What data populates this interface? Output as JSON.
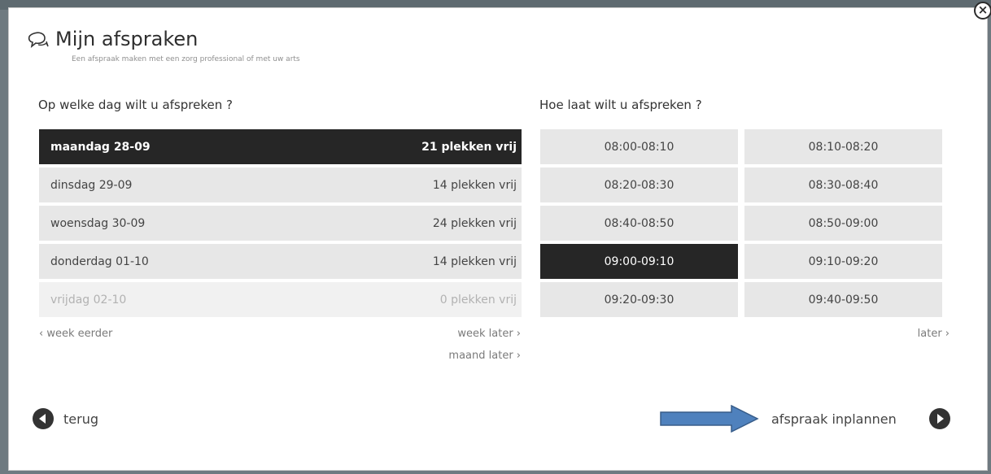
{
  "dialog": {
    "title": "Mijn afspraken",
    "subtitle": "Een afspraak maken met een zorg professional of met uw arts",
    "close_label": "×"
  },
  "days": {
    "heading": "Op welke dag wilt u afspreken ?",
    "items": [
      {
        "day": "maandag 28-09",
        "free": "21 plekken vrij",
        "state": "selected"
      },
      {
        "day": "dinsdag 29-09",
        "free": "14 plekken vrij",
        "state": "normal"
      },
      {
        "day": "woensdag 30-09",
        "free": "24 plekken vrij",
        "state": "normal"
      },
      {
        "day": "donderdag 01-10",
        "free": "14 plekken vrij",
        "state": "normal"
      },
      {
        "day": "vrijdag 02-10",
        "free": "0 plekken vrij",
        "state": "disabled"
      }
    ],
    "prev_week": "‹ week eerder",
    "next_week": "week later ›",
    "next_month": "maand later ›"
  },
  "times": {
    "heading": "Hoe laat wilt u afspreken ?",
    "slots": [
      {
        "label": "08:00-08:10",
        "selected": false
      },
      {
        "label": "08:10-08:20",
        "selected": false
      },
      {
        "label": "08:20-08:30",
        "selected": false
      },
      {
        "label": "08:30-08:40",
        "selected": false
      },
      {
        "label": "08:40-08:50",
        "selected": false
      },
      {
        "label": "08:50-09:00",
        "selected": false
      },
      {
        "label": "09:00-09:10",
        "selected": true
      },
      {
        "label": "09:10-09:20",
        "selected": false
      },
      {
        "label": "09:20-09:30",
        "selected": false
      },
      {
        "label": "09:40-09:50",
        "selected": false
      }
    ],
    "later": "later ›"
  },
  "footer": {
    "back_label": "terug",
    "submit_label": "afspraak inplannen"
  },
  "colors": {
    "selected": "#262626",
    "arrow": "#4f81bd"
  }
}
